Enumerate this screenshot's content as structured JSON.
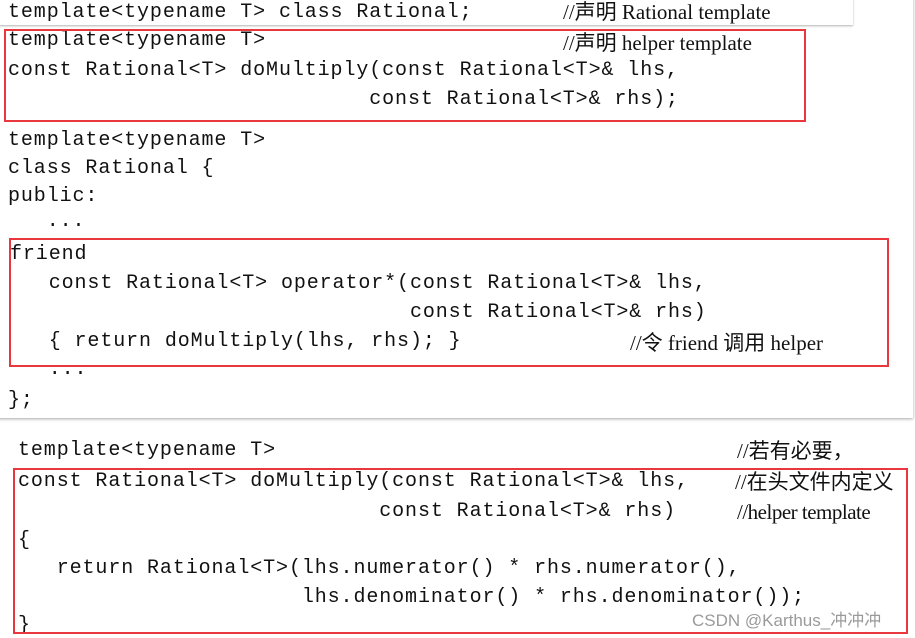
{
  "block1": {
    "lines": [
      "template<typename T> class Rational;",
      "template<typename T>",
      "const Rational<T> doMultiply(const Rational<T>& lhs,",
      "                            const Rational<T>& rhs);",
      "template<typename T>",
      "class Rational {",
      "public:",
      "   ...",
      "friend",
      "   const Rational<T> operator*(const Rational<T>& lhs,",
      "                               const Rational<T>& rhs)",
      "   { return doMultiply(lhs, rhs); }",
      "   ...",
      "};"
    ],
    "comments": [
      "//声明 Rational template",
      "//声明 helper template",
      "//令 friend 调用 helper"
    ]
  },
  "block2": {
    "lines": [
      "template<typename T>",
      "const Rational<T> doMultiply(const Rational<T>& lhs,",
      "                            const Rational<T>& rhs)",
      "{",
      "   return Rational<T>(lhs.numerator() * rhs.numerator(),",
      "                      lhs.denominator() * rhs.denominator());",
      "}"
    ],
    "comments": [
      "//若有必要，",
      "//在头文件内定义",
      "//helper template"
    ]
  },
  "watermark": "CSDN @Karthus_冲冲冲",
  "highlight_color": "#e8383d"
}
